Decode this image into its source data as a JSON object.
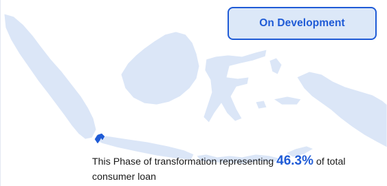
{
  "status_badge": {
    "label": "On Development",
    "border_color": "#1f5bd6",
    "fill_color": "#dce8f8",
    "text_color": "#1f5bd6"
  },
  "map": {
    "region_fill": "#dbe6f7",
    "highlight_fill": "#1f5bd6",
    "highlighted_region": "west-java-banten"
  },
  "caption": {
    "text_before": "This Phase of transformation representing ",
    "value": "46.3%",
    "text_after": " of total consumer loan"
  },
  "colors": {
    "accent": "#1f5bd6",
    "text": "#1a1a1a"
  }
}
